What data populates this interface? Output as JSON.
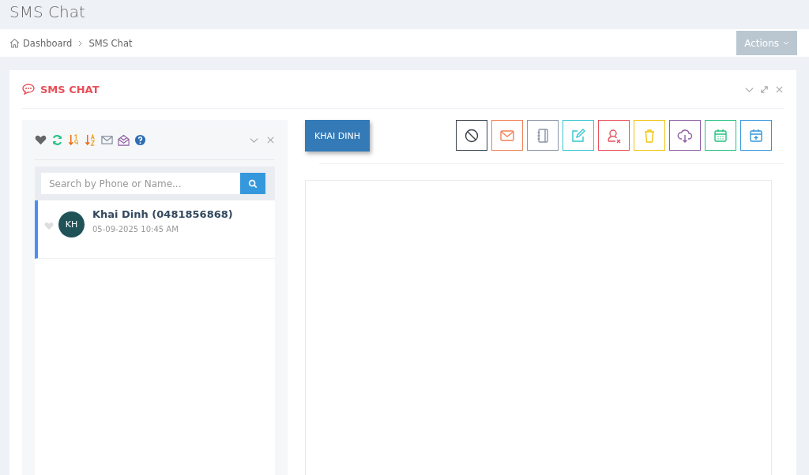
{
  "page_title": "SMS Chat",
  "breadcrumb": [
    "Dashboard",
    "SMS Chat"
  ],
  "actions_button": "Actions",
  "portlet_title": "SMS CHAT",
  "search": {
    "placeholder": "Search by Phone or Name..."
  },
  "conversations": [
    {
      "initials": "KH",
      "name": "Khai Dinh (0481856868)",
      "time": "05-09-2025 10:45 AM",
      "selected": true,
      "favorite": false
    }
  ],
  "contact_button": "KHAI DINH",
  "toolbar": [
    {
      "kind": "block"
    },
    {
      "kind": "mail"
    },
    {
      "kind": "notebook"
    },
    {
      "kind": "edit"
    },
    {
      "kind": "remove-user"
    },
    {
      "kind": "trash"
    },
    {
      "kind": "download"
    },
    {
      "kind": "calendar"
    },
    {
      "kind": "calendar-add"
    }
  ]
}
